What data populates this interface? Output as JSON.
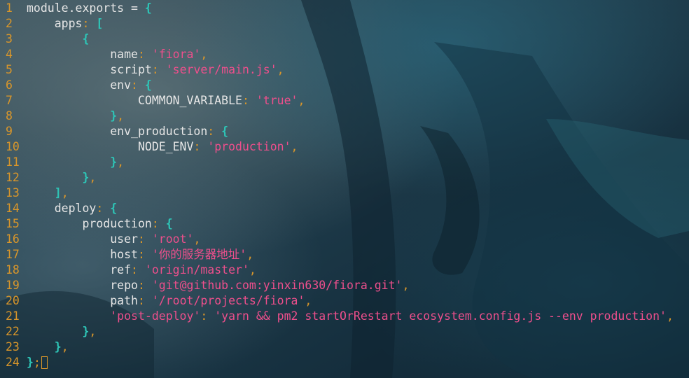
{
  "editor": {
    "file_language": "javascript",
    "lines": [
      {
        "n": "1",
        "indent": "",
        "parts": [
          {
            "t": "module.exports",
            "c": "code"
          },
          {
            "t": " = ",
            "c": "code"
          },
          {
            "t": "{",
            "c": "br"
          }
        ]
      },
      {
        "n": "2",
        "indent": "    ",
        "parts": [
          {
            "t": "apps",
            "c": "code"
          },
          {
            "t": ": ",
            "c": "p"
          },
          {
            "t": "[",
            "c": "br"
          }
        ]
      },
      {
        "n": "3",
        "indent": "        ",
        "parts": [
          {
            "t": "{",
            "c": "br"
          }
        ]
      },
      {
        "n": "4",
        "indent": "            ",
        "parts": [
          {
            "t": "name",
            "c": "code"
          },
          {
            "t": ": ",
            "c": "p"
          },
          {
            "t": "'fiora'",
            "c": "s"
          },
          {
            "t": ",",
            "c": "p"
          }
        ]
      },
      {
        "n": "5",
        "indent": "            ",
        "parts": [
          {
            "t": "script",
            "c": "code"
          },
          {
            "t": ": ",
            "c": "p"
          },
          {
            "t": "'server/main.js'",
            "c": "s"
          },
          {
            "t": ",",
            "c": "p"
          }
        ]
      },
      {
        "n": "6",
        "indent": "            ",
        "parts": [
          {
            "t": "env",
            "c": "code"
          },
          {
            "t": ": ",
            "c": "p"
          },
          {
            "t": "{",
            "c": "br"
          }
        ]
      },
      {
        "n": "7",
        "indent": "                ",
        "parts": [
          {
            "t": "COMMON_VARIABLE",
            "c": "code"
          },
          {
            "t": ": ",
            "c": "p"
          },
          {
            "t": "'true'",
            "c": "s"
          },
          {
            "t": ",",
            "c": "p"
          }
        ]
      },
      {
        "n": "8",
        "indent": "            ",
        "parts": [
          {
            "t": "}",
            "c": "br"
          },
          {
            "t": ",",
            "c": "p"
          }
        ]
      },
      {
        "n": "9",
        "indent": "            ",
        "parts": [
          {
            "t": "env_production",
            "c": "code"
          },
          {
            "t": ": ",
            "c": "p"
          },
          {
            "t": "{",
            "c": "br"
          }
        ]
      },
      {
        "n": "10",
        "indent": "                ",
        "parts": [
          {
            "t": "NODE_ENV",
            "c": "code"
          },
          {
            "t": ": ",
            "c": "p"
          },
          {
            "t": "'production'",
            "c": "s"
          },
          {
            "t": ",",
            "c": "p"
          }
        ]
      },
      {
        "n": "11",
        "indent": "            ",
        "parts": [
          {
            "t": "}",
            "c": "br"
          },
          {
            "t": ",",
            "c": "p"
          }
        ]
      },
      {
        "n": "12",
        "indent": "        ",
        "parts": [
          {
            "t": "}",
            "c": "br"
          },
          {
            "t": ",",
            "c": "p"
          }
        ]
      },
      {
        "n": "13",
        "indent": "    ",
        "parts": [
          {
            "t": "]",
            "c": "br"
          },
          {
            "t": ",",
            "c": "p"
          }
        ]
      },
      {
        "n": "14",
        "indent": "    ",
        "parts": [
          {
            "t": "deploy",
            "c": "code"
          },
          {
            "t": ": ",
            "c": "p"
          },
          {
            "t": "{",
            "c": "br"
          }
        ]
      },
      {
        "n": "15",
        "indent": "        ",
        "parts": [
          {
            "t": "production",
            "c": "code"
          },
          {
            "t": ": ",
            "c": "p"
          },
          {
            "t": "{",
            "c": "br"
          }
        ]
      },
      {
        "n": "16",
        "indent": "            ",
        "parts": [
          {
            "t": "user",
            "c": "code"
          },
          {
            "t": ": ",
            "c": "p"
          },
          {
            "t": "'root'",
            "c": "s"
          },
          {
            "t": ",",
            "c": "p"
          }
        ]
      },
      {
        "n": "17",
        "indent": "            ",
        "parts": [
          {
            "t": "host",
            "c": "code"
          },
          {
            "t": ": ",
            "c": "p"
          },
          {
            "t": "'你的服务器地址'",
            "c": "s"
          },
          {
            "t": ",",
            "c": "p"
          }
        ]
      },
      {
        "n": "18",
        "indent": "            ",
        "parts": [
          {
            "t": "ref",
            "c": "code"
          },
          {
            "t": ": ",
            "c": "p"
          },
          {
            "t": "'origin/master'",
            "c": "s"
          },
          {
            "t": ",",
            "c": "p"
          }
        ]
      },
      {
        "n": "19",
        "indent": "            ",
        "parts": [
          {
            "t": "repo",
            "c": "code"
          },
          {
            "t": ": ",
            "c": "p"
          },
          {
            "t": "'git@github.com:yinxin630/fiora.git'",
            "c": "s"
          },
          {
            "t": ",",
            "c": "p"
          }
        ]
      },
      {
        "n": "20",
        "indent": "            ",
        "parts": [
          {
            "t": "path",
            "c": "code"
          },
          {
            "t": ": ",
            "c": "p"
          },
          {
            "t": "'/root/projects/fiora'",
            "c": "s"
          },
          {
            "t": ",",
            "c": "p"
          }
        ]
      },
      {
        "n": "21",
        "indent": "            ",
        "parts": [
          {
            "t": "'post-deploy'",
            "c": "s"
          },
          {
            "t": ": ",
            "c": "p"
          },
          {
            "t": "'yarn && pm2 startOrRestart ecosystem.config.js --env production'",
            "c": "s"
          },
          {
            "t": ",",
            "c": "p"
          }
        ]
      },
      {
        "n": "22",
        "indent": "        ",
        "parts": [
          {
            "t": "}",
            "c": "br"
          },
          {
            "t": ",",
            "c": "p"
          }
        ]
      },
      {
        "n": "23",
        "indent": "    ",
        "parts": [
          {
            "t": "}",
            "c": "br"
          },
          {
            "t": ",",
            "c": "p"
          }
        ]
      },
      {
        "n": "24",
        "indent": "",
        "parts": [
          {
            "t": "}",
            "c": "br"
          },
          {
            "t": ";",
            "c": "p"
          }
        ],
        "cursor": true
      }
    ]
  },
  "colors": {
    "line_number": "#d9962a",
    "punctuation": "#d9962a",
    "bracket": "#2ec4b6",
    "string": "#ee4f8c",
    "identifier": "#e6e6e6",
    "background": "#1c3342"
  }
}
